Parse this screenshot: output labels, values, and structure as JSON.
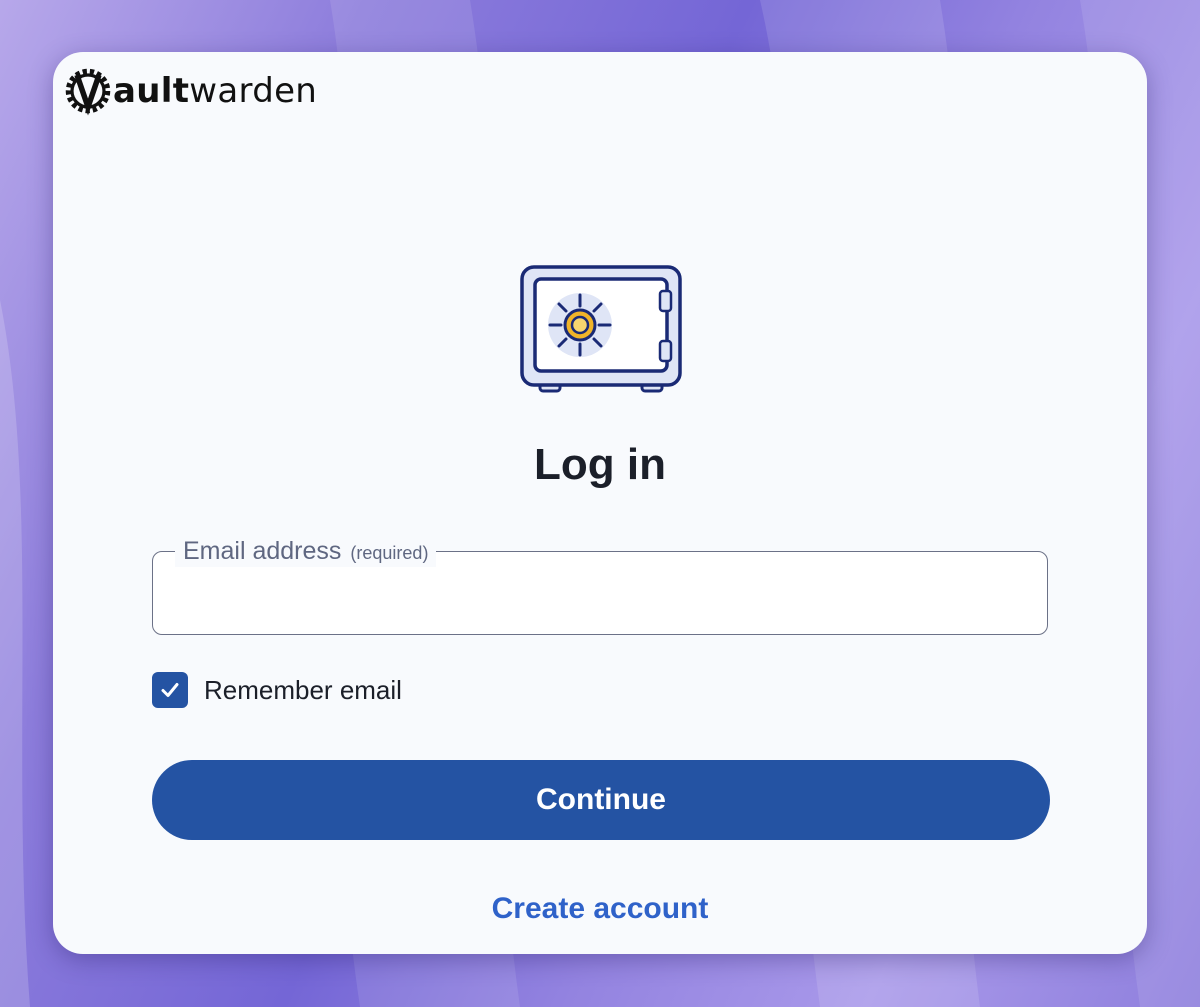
{
  "brand": {
    "logo_icon": "vaultwarden-gear-v-icon",
    "name_bold": "ault",
    "name_light": "warden"
  },
  "page": {
    "illustration": "safe-icon",
    "title": "Log in"
  },
  "email_field": {
    "label": "Email address",
    "required_note": "(required)",
    "value": ""
  },
  "remember": {
    "label": "Remember email",
    "checked": true,
    "icon": "checkmark-icon"
  },
  "actions": {
    "continue_label": "Continue",
    "create_account_label": "Create account"
  },
  "colors": {
    "primary": "#2453a3",
    "link": "#2f62c9",
    "card_background": "#f8fafd",
    "safe_dial": "#f0b429"
  }
}
